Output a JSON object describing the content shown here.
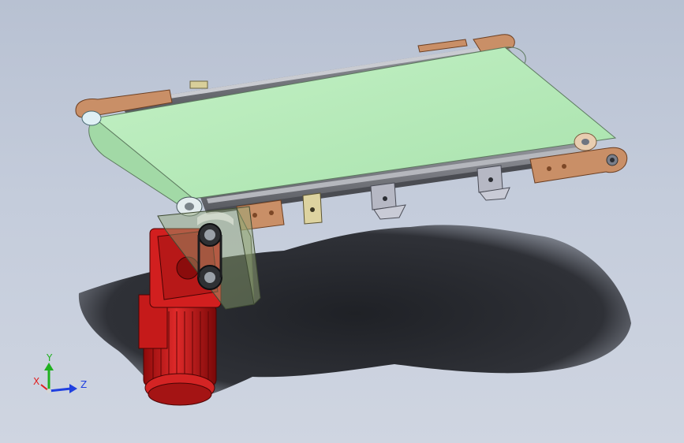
{
  "viewport": {
    "background_top": "#b8c1d2",
    "background_bottom": "#cfd5e1",
    "model": {
      "belt_color": "#b2e9b6",
      "frame_color": "#7d7f86",
      "bracket_color": "#c98f67",
      "motor_color": "#d61c1c",
      "guard_color": "#8ea470",
      "shadow_color": "#2a2c31"
    },
    "triad": {
      "x_label": "X",
      "y_label": "Y",
      "z_label": "Z",
      "x_color": "#e02020",
      "y_color": "#20b020",
      "z_color": "#2040e0"
    }
  }
}
